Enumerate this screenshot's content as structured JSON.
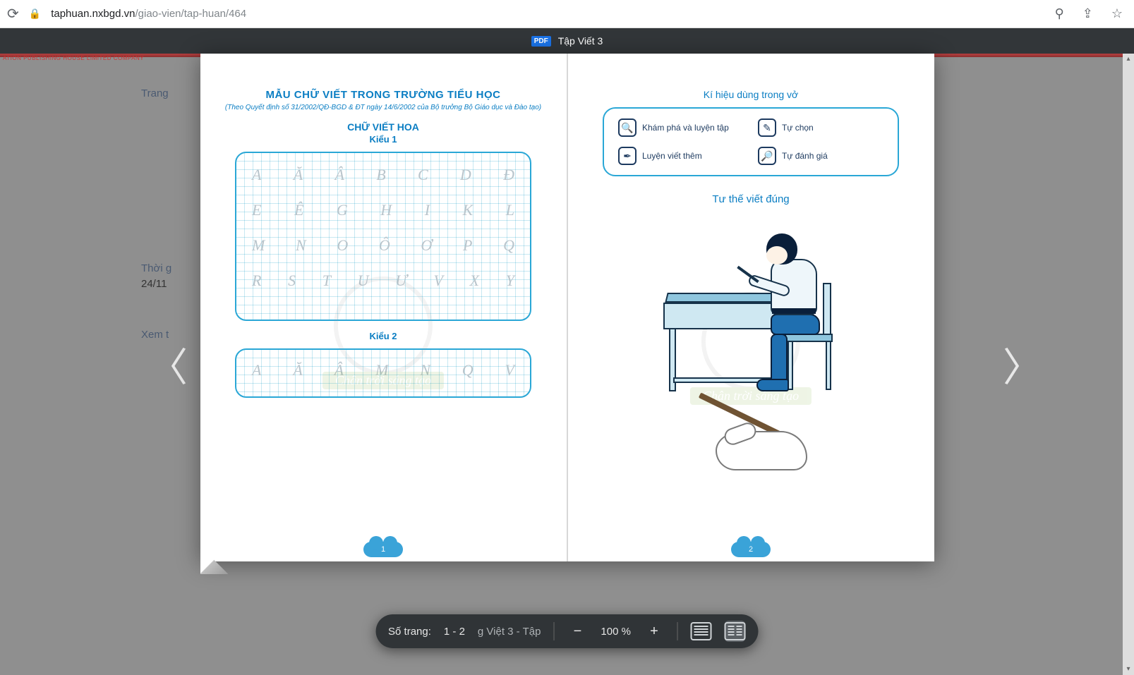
{
  "browser": {
    "host": "taphuan.nxbgd.vn",
    "path": "/giao-vien/tap-huan/464"
  },
  "pdf": {
    "title": "Tập Viết 3",
    "badge": "PDF"
  },
  "background": {
    "publisher_strip": "ATION PUBLISHING HOUSE LIMITED COMPANY",
    "nav_trang": "Trang",
    "thoi": "Thời g",
    "date": "24/11",
    "xem": "Xem t"
  },
  "left_page": {
    "title": "MẪU CHỮ VIẾT TRONG TRƯỜNG TIỂU HỌC",
    "subtitle": "(Theo Quyết định số 31/2002/QĐ-BGD & ĐT ngày 14/6/2002 của Bộ trưởng Bộ Giáo dục và Đào tạo)",
    "section": "CHỮ VIẾT HOA",
    "kieu1": "Kiểu 1",
    "kieu2": "Kiểu 2",
    "rows1": [
      [
        "A",
        "Ă",
        "Â",
        "B",
        "C",
        "D",
        "Đ"
      ],
      [
        "E",
        "Ê",
        "G",
        "H",
        "I",
        "K",
        "L"
      ],
      [
        "M",
        "N",
        "O",
        "Ô",
        "Ơ",
        "P",
        "Q"
      ],
      [
        "R",
        "S",
        "T",
        "U",
        "Ư",
        "V",
        "X",
        "Y"
      ]
    ],
    "rows2": [
      [
        "A",
        "Ă",
        "Â",
        "M",
        "N",
        "Q",
        "V"
      ]
    ],
    "watermark": "Chân trời sáng tạo",
    "pagenum": "1"
  },
  "right_page": {
    "legend_title": "Kí hiệu dùng trong vở",
    "legend": [
      {
        "icon": "🔍",
        "label": "Khám phá và luyện tập"
      },
      {
        "icon": "✎",
        "label": "Tự chọn"
      },
      {
        "icon": "✒",
        "label": "Luyện viết thêm"
      },
      {
        "icon": "🔎",
        "label": "Tự đánh giá"
      }
    ],
    "posture_title": "Tư thế viết đúng",
    "watermark": "Chân trời sáng tạo",
    "pagenum": "2"
  },
  "toolbar": {
    "page_label": "Số trang:",
    "page_value": "1 - 2",
    "zoom": "100 %",
    "hidden_text": "g Việt 3 - Tập"
  }
}
